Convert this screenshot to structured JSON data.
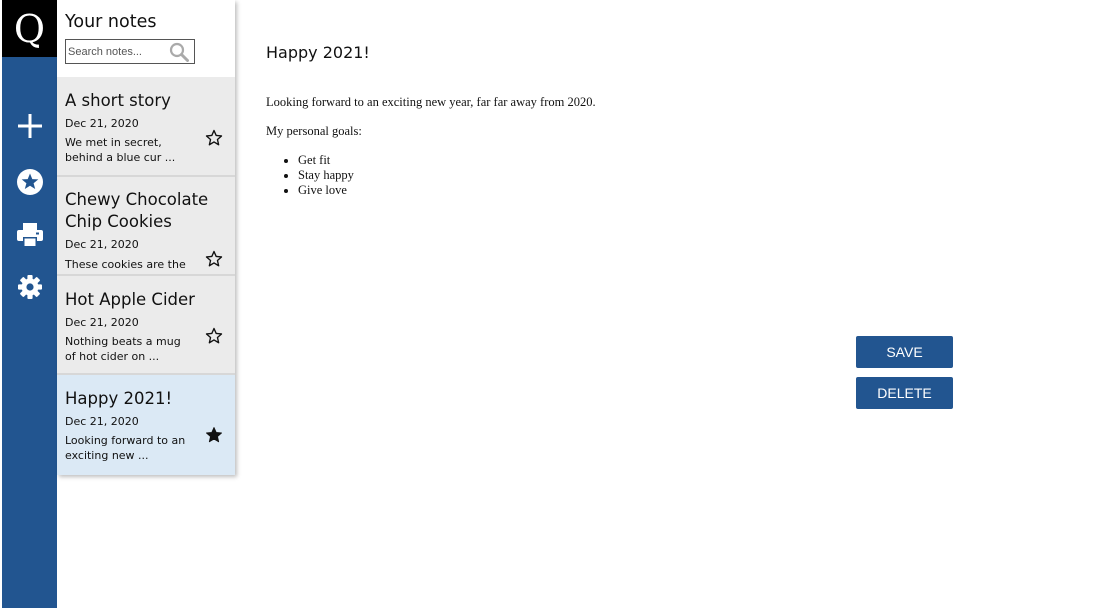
{
  "app": {
    "logo_letter": "Q"
  },
  "sidebar": {
    "actions": [
      {
        "name": "add-note",
        "icon": "plus-icon"
      },
      {
        "name": "favorites",
        "icon": "star-circle-icon"
      },
      {
        "name": "print",
        "icon": "printer-icon"
      },
      {
        "name": "settings",
        "icon": "gear-icon"
      }
    ]
  },
  "notes_panel": {
    "title": "Your notes",
    "search": {
      "placeholder": "Search notes...",
      "value": ""
    },
    "notes": [
      {
        "title": "A short story",
        "date": "Dec 21, 2020",
        "preview": "We met in secret, behind a blue cur ...",
        "starred": false
      },
      {
        "title": "Chewy Chocolate Chip Cookies",
        "date": "Dec 21, 2020",
        "preview": "These cookies are the",
        "starred": false
      },
      {
        "title": "Hot Apple Cider",
        "date": "Dec 21, 2020",
        "preview": "Nothing beats a mug of hot cider on ...",
        "starred": false
      },
      {
        "title": "Happy 2021!",
        "date": "Dec 21, 2020",
        "preview": "Looking forward to an exciting new ...",
        "starred": true,
        "selected": true
      }
    ]
  },
  "editor": {
    "title": "Happy 2021!",
    "paragraph1": "Looking forward to an exciting new year, far far away from 2020.",
    "paragraph2": "My personal goals:",
    "list": [
      "Get fit",
      "Stay happy",
      "Give love"
    ],
    "save_label": "SAVE",
    "delete_label": "DELETE"
  },
  "colors": {
    "accent": "#225590",
    "selected_note": "#dbe9f5",
    "note_bg": "#ebebeb"
  }
}
